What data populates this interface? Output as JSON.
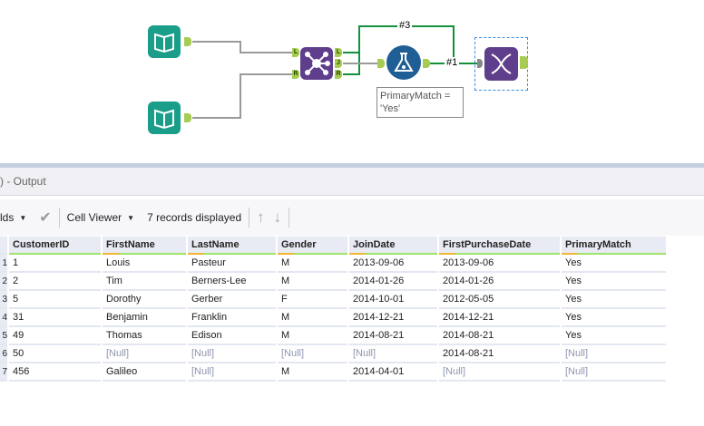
{
  "canvas": {
    "wire_labels": [
      "#3",
      "#1"
    ],
    "anchors": {
      "left": "L",
      "join": "J",
      "right": "R"
    },
    "filter_annotation": "PrimaryMatch = 'Yes'",
    "colors": {
      "input": "#1a9e8a",
      "join": "#5f3e8c",
      "filter": "#1f5f96",
      "output": "#5f3e8c",
      "wire_green": "#14913a",
      "wire_gray": "#999999"
    }
  },
  "panel": {
    "title": ") - Output"
  },
  "toolbar": {
    "fields_label": "lds",
    "cell_viewer_label": "Cell Viewer",
    "records_displayed": "7 records displayed"
  },
  "table": {
    "columns": [
      "CustomerID",
      "FirstName",
      "LastName",
      "Gender",
      "JoinDate",
      "FirstPurchaseDate",
      "PrimaryMatch"
    ],
    "rows": [
      {
        "n": "1",
        "cells": [
          "1",
          "Louis",
          "Pasteur",
          "M",
          "2013-09-06",
          "2013-09-06",
          "Yes"
        ]
      },
      {
        "n": "2",
        "cells": [
          "2",
          "Tim",
          "Berners-Lee",
          "M",
          "2014-01-26",
          "2014-01-26",
          "Yes"
        ]
      },
      {
        "n": "3",
        "cells": [
          "5",
          "Dorothy",
          "Gerber",
          "F",
          "2014-10-01",
          "2012-05-05",
          "Yes"
        ]
      },
      {
        "n": "4",
        "cells": [
          "31",
          "Benjamin",
          "Franklin",
          "M",
          "2014-12-21",
          "2014-12-21",
          "Yes"
        ]
      },
      {
        "n": "5",
        "cells": [
          "49",
          "Thomas",
          "Edison",
          "M",
          "2014-08-21",
          "2014-08-21",
          "Yes"
        ]
      },
      {
        "n": "6",
        "cells": [
          "50",
          "[Null]",
          "[Null]",
          "[Null]",
          "[Null]",
          "2014-08-21",
          "[Null]"
        ]
      },
      {
        "n": "7",
        "cells": [
          "456",
          "Galileo",
          "[Null]",
          "M",
          "2014-04-01",
          "[Null]",
          "[Null]"
        ]
      }
    ]
  }
}
